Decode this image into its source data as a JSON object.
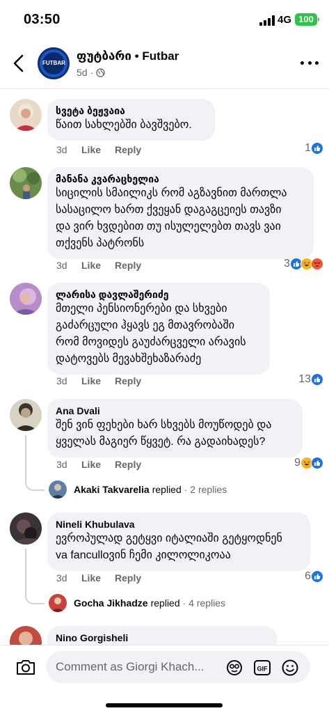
{
  "status_bar": {
    "time": "03:50",
    "network": "4G",
    "battery": "100"
  },
  "header": {
    "title": "ფუტბარი • Futbar",
    "age": "5d",
    "avatar_text": "FUTBAR"
  },
  "comments": [
    {
      "author": "სვეტა ბეჟვაია",
      "lines": [
        "წაით სახლებში ბავშვებო."
      ],
      "time": "3d",
      "like_label": "Like",
      "reply_label": "Reply",
      "reaction_count": "1",
      "reactions": [
        "like"
      ]
    },
    {
      "author": "მანანა კვარაცხელია",
      "lines": [
        "სიცილის სმაილიკს რომ აგზავნით მართლა",
        "სასაცილო ხართ ქვეყან დაგაგცეიეს თავზი",
        "და ვირ ხვდებით თუ ისულელებთ თავს ვაი",
        "თქვენს პატრონს"
      ],
      "time": "3d",
      "like_label": "Like",
      "reply_label": "Reply",
      "reaction_count": "3",
      "reactions": [
        "like",
        "haha",
        "angry"
      ]
    },
    {
      "author": "ლარისა დავლაშერიძე",
      "lines": [
        "მთელი პენსიონერები და სხვები",
        "გაძარცული ჰყავს ეგ მთავრობაში",
        "რომ მოვიდეს გაუძარცველი არავის",
        "დატოვებს მევახშეხაზარაძე"
      ],
      "time": "3d",
      "like_label": "Like",
      "reply_label": "Reply",
      "reaction_count": "13",
      "reactions": [
        "like"
      ]
    },
    {
      "author": "Ana Dvali",
      "lines": [
        "შენ ვინ ფეხები ხარ სხვებს მოუწოდებ და",
        "ყველას მაგიერ წყვეტ. რა გადაიხადეს?"
      ],
      "time": "3d",
      "like_label": "Like",
      "reply_label": "Reply",
      "reaction_count": "9",
      "reactions": [
        "haha",
        "like"
      ],
      "replies": {
        "name": "Akaki Takvarelia",
        "verb": "replied",
        "count": "· 2 replies"
      }
    },
    {
      "author": "Nineli Khubulava",
      "lines": [
        "ევროპულად გეტყვი იტალიაში გეტყოდნენ",
        "va fanculloვინ ჩემი კილოლიკოაა"
      ],
      "time": "3d",
      "like_label": "Like",
      "reply_label": "Reply",
      "reaction_count": "6",
      "reactions": [
        "like"
      ],
      "replies": {
        "name": "Gocha Jikhadze",
        "verb": "replied",
        "count": "· 4 replies"
      }
    },
    {
      "author": "Nino Gorgisheli",
      "lines": []
    }
  ],
  "composer": {
    "placeholder": "Comment as Giorgi Khach..."
  },
  "colors": {
    "like": "#1b74e4",
    "bubble": "#f0f2f5",
    "meta": "#65676b",
    "battery": "#2fc449"
  }
}
